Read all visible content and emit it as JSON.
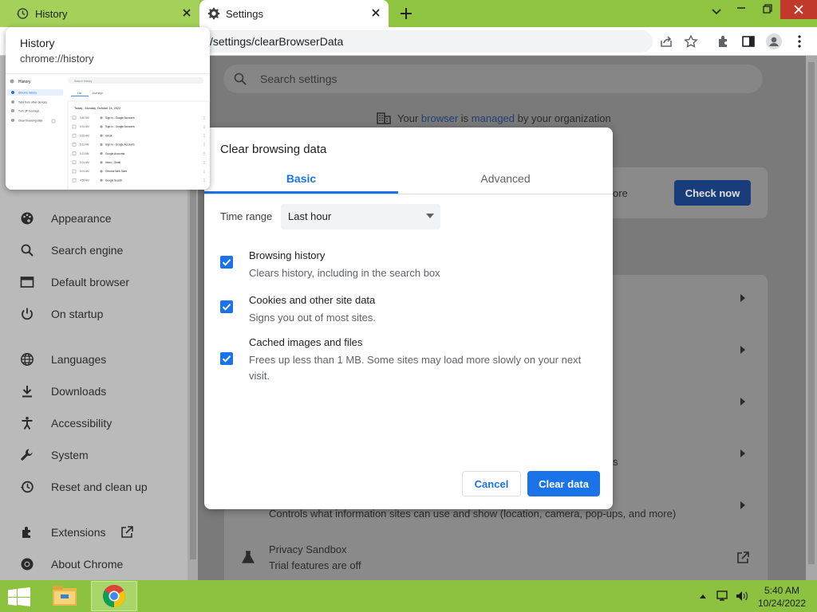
{
  "browser": {
    "tabs": [
      {
        "title": "History",
        "icon": "history-icon"
      },
      {
        "title": "Settings",
        "icon": "gear-icon"
      }
    ],
    "url": "/settings/clearBrowserData"
  },
  "hover_card": {
    "title": "History",
    "url": "chrome://history",
    "thumbnail": {
      "heading": "History",
      "search_placeholder": "Search history",
      "nav": [
        "Chrome history",
        "Tabs from other devices",
        "Turn off Journeys",
        "Clear browsing data"
      ],
      "tabs": [
        "List",
        "Journeys"
      ],
      "date": "Today - Monday, October 24, 2022",
      "entries": [
        {
          "time": "5:40 AM",
          "title": "Sign in - Google Accounts"
        },
        {
          "time": "5:31 AM",
          "title": "Sign in - Google Accounts"
        },
        {
          "time": "5:21 AM",
          "title": "Gmail"
        },
        {
          "time": "5:11 AM",
          "title": "Sign in - Google Accounts"
        },
        {
          "time": "5:11 AM",
          "title": "Google Accounts"
        },
        {
          "time": "5:01 AM",
          "title": "Inbox - Gmail"
        },
        {
          "time": "5:01 AM",
          "title": "Chrome Web Store"
        },
        {
          "time": "4:55 AM",
          "title": "Google Search"
        }
      ]
    }
  },
  "settings": {
    "search_placeholder": "Search settings",
    "managed_notice": {
      "prefix": "Your",
      "link1": "browser",
      "middle": "is",
      "link2": "managed",
      "suffix": "by your organization"
    },
    "sidebar": [
      {
        "label": "Appearance",
        "icon": "palette-icon"
      },
      {
        "label": "Search engine",
        "icon": "search-icon"
      },
      {
        "label": "Default browser",
        "icon": "browser-icon"
      },
      {
        "label": "On startup",
        "icon": "power-icon"
      },
      {
        "label": "Languages",
        "icon": "globe-icon"
      },
      {
        "label": "Downloads",
        "icon": "download-icon"
      },
      {
        "label": "Accessibility",
        "icon": "accessibility-icon"
      },
      {
        "label": "System",
        "icon": "wrench-icon"
      },
      {
        "label": "Reset and clean up",
        "icon": "reset-icon"
      },
      {
        "label": "Extensions",
        "icon": "puzzle-icon"
      },
      {
        "label": "About Chrome",
        "icon": "chrome-icon"
      }
    ],
    "safety_check": {
      "partial_text": "ore",
      "button": "Check now"
    },
    "site_settings_desc": "Controls what information sites can use and show (location, camera, pop-ups, and more)",
    "partial_text_2": "s",
    "privacy_sandbox": {
      "title": "Privacy Sandbox",
      "description": "Trial features are off"
    }
  },
  "dialog": {
    "title": "Clear browsing data",
    "tabs": {
      "basic": "Basic",
      "advanced": "Advanced"
    },
    "time_range": {
      "label": "Time range",
      "value": "Last hour"
    },
    "options": [
      {
        "title": "Browsing history",
        "description": "Clears history, including in the search box",
        "checked": true
      },
      {
        "title": "Cookies and other site data",
        "description": "Signs you out of most sites.",
        "checked": true
      },
      {
        "title": "Cached images and files",
        "description": "Frees up less than 1 MB. Some sites may load more slowly on your next visit.",
        "checked": true
      }
    ],
    "cancel": "Cancel",
    "clear": "Clear data"
  },
  "taskbar": {
    "time": "5:40 AM",
    "date": "10/24/2022"
  },
  "colors": {
    "accent": "#1a73e8",
    "titlebar": "#8fc440",
    "taskbar": "#8cc23f",
    "close": "#c1392b"
  }
}
